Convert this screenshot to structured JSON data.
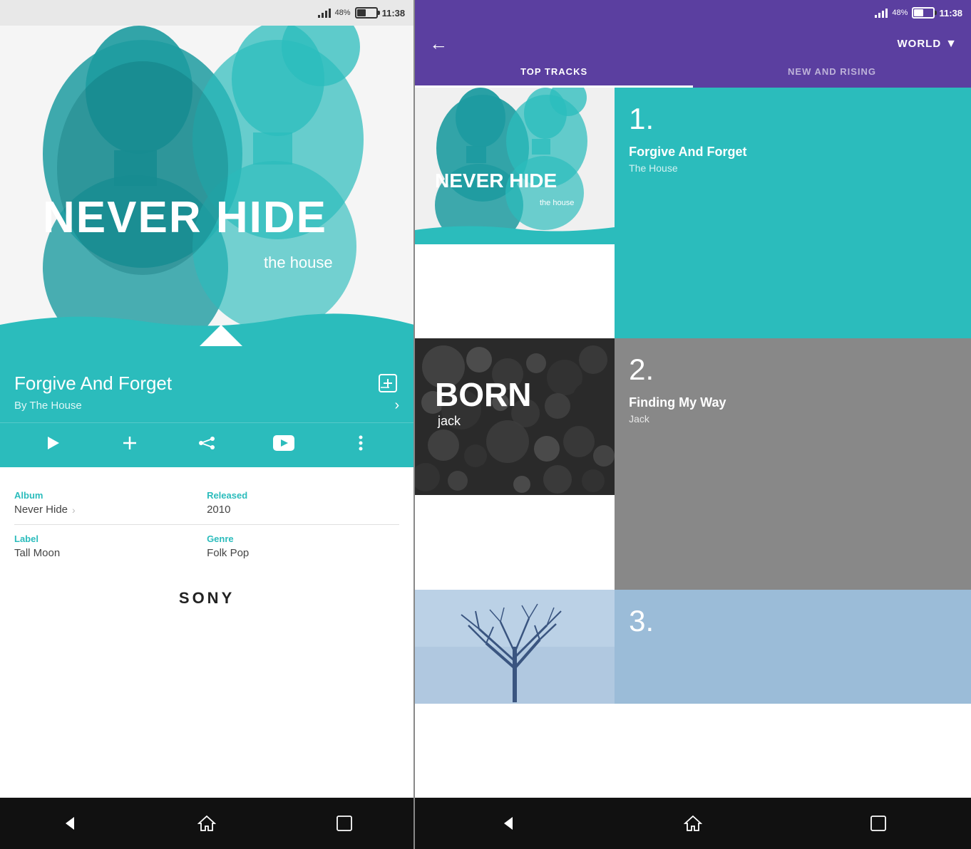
{
  "left": {
    "status": {
      "battery_pct": "48%",
      "time": "11:38"
    },
    "song": {
      "title": "Forgive And Forget",
      "artist": "By The House"
    },
    "details": {
      "album_label": "Album",
      "album_value": "Never Hide",
      "released_label": "Released",
      "released_value": "2010",
      "label_label": "Label",
      "label_value": "Tall Moon",
      "genre_label": "Genre",
      "genre_value": "Folk Pop"
    },
    "sony_logo": "SONY",
    "actions": {
      "play": "▶",
      "add": "+",
      "share": "⋈",
      "youtube": "▶",
      "more": "⋮"
    }
  },
  "right": {
    "status": {
      "battery_pct": "48%",
      "time": "11:38"
    },
    "header": {
      "location": "WORLD",
      "back": "←"
    },
    "tabs": [
      {
        "label": "TOP TRACKS",
        "active": true
      },
      {
        "label": "NEW AND RISING",
        "active": false
      }
    ],
    "tracks": [
      {
        "number": "1.",
        "title": "Forgive And Forget",
        "artist": "The House"
      },
      {
        "number": "2.",
        "title": "Finding My Way",
        "artist": "Jack"
      },
      {
        "number": "3.",
        "title": "",
        "artist": ""
      }
    ]
  }
}
